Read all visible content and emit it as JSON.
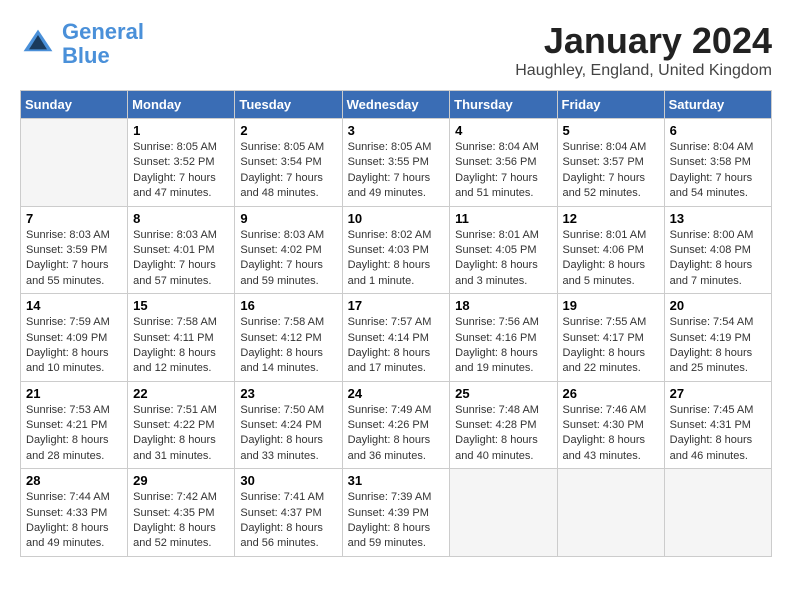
{
  "header": {
    "logo_line1": "General",
    "logo_line2": "Blue",
    "month": "January 2024",
    "location": "Haughley, England, United Kingdom"
  },
  "days_of_week": [
    "Sunday",
    "Monday",
    "Tuesday",
    "Wednesday",
    "Thursday",
    "Friday",
    "Saturday"
  ],
  "weeks": [
    [
      {
        "day": "",
        "empty": true
      },
      {
        "day": "1",
        "sunrise": "8:05 AM",
        "sunset": "3:52 PM",
        "daylight": "7 hours and 47 minutes."
      },
      {
        "day": "2",
        "sunrise": "8:05 AM",
        "sunset": "3:54 PM",
        "daylight": "7 hours and 48 minutes."
      },
      {
        "day": "3",
        "sunrise": "8:05 AM",
        "sunset": "3:55 PM",
        "daylight": "7 hours and 49 minutes."
      },
      {
        "day": "4",
        "sunrise": "8:04 AM",
        "sunset": "3:56 PM",
        "daylight": "7 hours and 51 minutes."
      },
      {
        "day": "5",
        "sunrise": "8:04 AM",
        "sunset": "3:57 PM",
        "daylight": "7 hours and 52 minutes."
      },
      {
        "day": "6",
        "sunrise": "8:04 AM",
        "sunset": "3:58 PM",
        "daylight": "7 hours and 54 minutes."
      }
    ],
    [
      {
        "day": "7",
        "sunrise": "8:03 AM",
        "sunset": "3:59 PM",
        "daylight": "7 hours and 55 minutes."
      },
      {
        "day": "8",
        "sunrise": "8:03 AM",
        "sunset": "4:01 PM",
        "daylight": "7 hours and 57 minutes."
      },
      {
        "day": "9",
        "sunrise": "8:03 AM",
        "sunset": "4:02 PM",
        "daylight": "7 hours and 59 minutes."
      },
      {
        "day": "10",
        "sunrise": "8:02 AM",
        "sunset": "4:03 PM",
        "daylight": "8 hours and 1 minute."
      },
      {
        "day": "11",
        "sunrise": "8:01 AM",
        "sunset": "4:05 PM",
        "daylight": "8 hours and 3 minutes."
      },
      {
        "day": "12",
        "sunrise": "8:01 AM",
        "sunset": "4:06 PM",
        "daylight": "8 hours and 5 minutes."
      },
      {
        "day": "13",
        "sunrise": "8:00 AM",
        "sunset": "4:08 PM",
        "daylight": "8 hours and 7 minutes."
      }
    ],
    [
      {
        "day": "14",
        "sunrise": "7:59 AM",
        "sunset": "4:09 PM",
        "daylight": "8 hours and 10 minutes."
      },
      {
        "day": "15",
        "sunrise": "7:58 AM",
        "sunset": "4:11 PM",
        "daylight": "8 hours and 12 minutes."
      },
      {
        "day": "16",
        "sunrise": "7:58 AM",
        "sunset": "4:12 PM",
        "daylight": "8 hours and 14 minutes."
      },
      {
        "day": "17",
        "sunrise": "7:57 AM",
        "sunset": "4:14 PM",
        "daylight": "8 hours and 17 minutes."
      },
      {
        "day": "18",
        "sunrise": "7:56 AM",
        "sunset": "4:16 PM",
        "daylight": "8 hours and 19 minutes."
      },
      {
        "day": "19",
        "sunrise": "7:55 AM",
        "sunset": "4:17 PM",
        "daylight": "8 hours and 22 minutes."
      },
      {
        "day": "20",
        "sunrise": "7:54 AM",
        "sunset": "4:19 PM",
        "daylight": "8 hours and 25 minutes."
      }
    ],
    [
      {
        "day": "21",
        "sunrise": "7:53 AM",
        "sunset": "4:21 PM",
        "daylight": "8 hours and 28 minutes."
      },
      {
        "day": "22",
        "sunrise": "7:51 AM",
        "sunset": "4:22 PM",
        "daylight": "8 hours and 31 minutes."
      },
      {
        "day": "23",
        "sunrise": "7:50 AM",
        "sunset": "4:24 PM",
        "daylight": "8 hours and 33 minutes."
      },
      {
        "day": "24",
        "sunrise": "7:49 AM",
        "sunset": "4:26 PM",
        "daylight": "8 hours and 36 minutes."
      },
      {
        "day": "25",
        "sunrise": "7:48 AM",
        "sunset": "4:28 PM",
        "daylight": "8 hours and 40 minutes."
      },
      {
        "day": "26",
        "sunrise": "7:46 AM",
        "sunset": "4:30 PM",
        "daylight": "8 hours and 43 minutes."
      },
      {
        "day": "27",
        "sunrise": "7:45 AM",
        "sunset": "4:31 PM",
        "daylight": "8 hours and 46 minutes."
      }
    ],
    [
      {
        "day": "28",
        "sunrise": "7:44 AM",
        "sunset": "4:33 PM",
        "daylight": "8 hours and 49 minutes."
      },
      {
        "day": "29",
        "sunrise": "7:42 AM",
        "sunset": "4:35 PM",
        "daylight": "8 hours and 52 minutes."
      },
      {
        "day": "30",
        "sunrise": "7:41 AM",
        "sunset": "4:37 PM",
        "daylight": "8 hours and 56 minutes."
      },
      {
        "day": "31",
        "sunrise": "7:39 AM",
        "sunset": "4:39 PM",
        "daylight": "8 hours and 59 minutes."
      },
      {
        "day": "",
        "empty": true
      },
      {
        "day": "",
        "empty": true
      },
      {
        "day": "",
        "empty": true
      }
    ]
  ]
}
